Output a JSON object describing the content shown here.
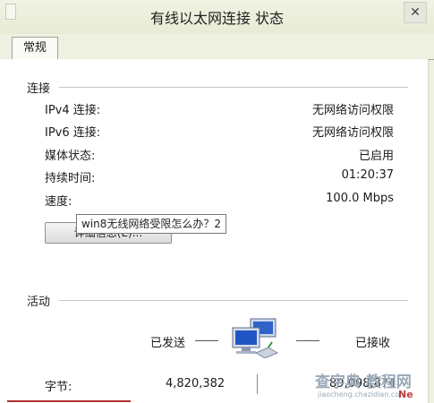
{
  "window": {
    "title": "有线以太网连接 状态",
    "close_glyph": "✕"
  },
  "tabs": [
    {
      "label": "常规"
    }
  ],
  "connection": {
    "section_title": "连接",
    "rows": [
      {
        "label": "IPv4 连接:",
        "value": "无网络访问权限"
      },
      {
        "label": "IPv6 连接:",
        "value": "无网络访问权限"
      },
      {
        "label": "媒体状态:",
        "value": "已启用"
      },
      {
        "label": "持续时间:",
        "value": "01:20:37"
      },
      {
        "label": "速度:",
        "value": "100.0 Mbps"
      }
    ],
    "details_button": "详细信息(E)...",
    "tooltip": "win8无线网络受限怎么办？2"
  },
  "activity": {
    "section_title": "活动",
    "sent_label": "已发送",
    "received_label": "已接收",
    "bytes_label": "字节:",
    "bytes_sent": "4,820,382",
    "bytes_received": "89,098,874",
    "icon": "network-computers-icon"
  },
  "watermark": {
    "main": "查字典 教程网",
    "sub": "jiaocheng.chazidian.com",
    "red": "Ne"
  },
  "colors": {
    "accent": "#b03030",
    "watermark": "#9aa8b5"
  }
}
